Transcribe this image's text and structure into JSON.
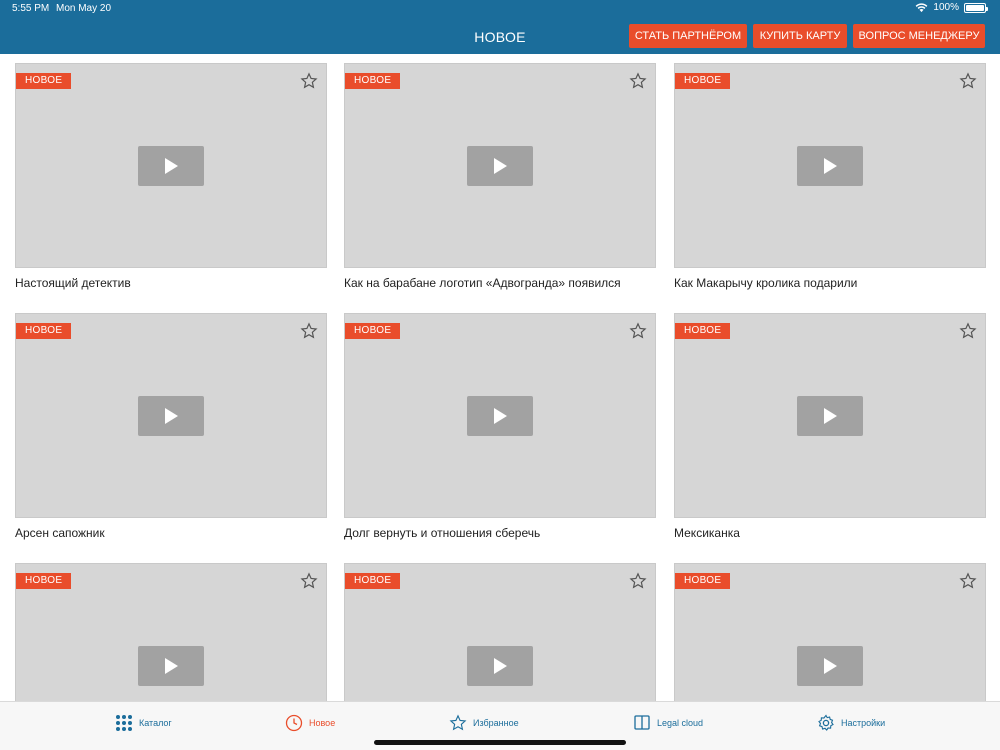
{
  "status": {
    "time": "5:55 PM",
    "date": "Mon May 20",
    "battery": "100%"
  },
  "header": {
    "title": "НОВОЕ",
    "buttons": {
      "partner": "СТАТЬ ПАРТНЁРОМ",
      "buy_card": "КУПИТЬ КАРТУ",
      "manager": "ВОПРОС МЕНЕДЖЕРУ"
    }
  },
  "cards": [
    {
      "badge": "НОВОЕ",
      "title": "Настоящий детектив"
    },
    {
      "badge": "НОВОЕ",
      "title": "Как на барабане логотип «Адвогранда» появился"
    },
    {
      "badge": "НОВОЕ",
      "title": "Как Макарычу кролика подарили"
    },
    {
      "badge": "НОВОЕ",
      "title": "Арсен сапожник"
    },
    {
      "badge": "НОВОЕ",
      "title": "Долг вернуть и отношения сберечь"
    },
    {
      "badge": "НОВОЕ",
      "title": "Мексиканка"
    },
    {
      "badge": "НОВОЕ",
      "title": ""
    },
    {
      "badge": "НОВОЕ",
      "title": ""
    },
    {
      "badge": "НОВОЕ",
      "title": ""
    }
  ],
  "tabbar": {
    "catalog": "Каталог",
    "new": "Новое",
    "favorites": "Избранное",
    "legal_cloud": "Legal cloud",
    "settings": "Настройки"
  },
  "colors": {
    "header_bg": "#1b6d9b",
    "accent": "#e94d2b",
    "tab_inactive": "#1b6d9b"
  }
}
